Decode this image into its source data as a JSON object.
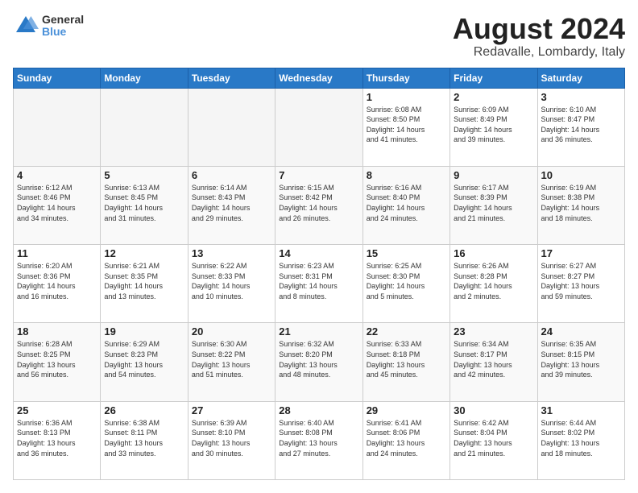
{
  "header": {
    "logo_general": "General",
    "logo_blue": "Blue",
    "title": "August 2024",
    "subtitle": "Redavalle, Lombardy, Italy"
  },
  "weekdays": [
    "Sunday",
    "Monday",
    "Tuesday",
    "Wednesday",
    "Thursday",
    "Friday",
    "Saturday"
  ],
  "weeks": [
    [
      {
        "day": "",
        "info": ""
      },
      {
        "day": "",
        "info": ""
      },
      {
        "day": "",
        "info": ""
      },
      {
        "day": "",
        "info": ""
      },
      {
        "day": "1",
        "info": "Sunrise: 6:08 AM\nSunset: 8:50 PM\nDaylight: 14 hours\nand 41 minutes."
      },
      {
        "day": "2",
        "info": "Sunrise: 6:09 AM\nSunset: 8:49 PM\nDaylight: 14 hours\nand 39 minutes."
      },
      {
        "day": "3",
        "info": "Sunrise: 6:10 AM\nSunset: 8:47 PM\nDaylight: 14 hours\nand 36 minutes."
      }
    ],
    [
      {
        "day": "4",
        "info": "Sunrise: 6:12 AM\nSunset: 8:46 PM\nDaylight: 14 hours\nand 34 minutes."
      },
      {
        "day": "5",
        "info": "Sunrise: 6:13 AM\nSunset: 8:45 PM\nDaylight: 14 hours\nand 31 minutes."
      },
      {
        "day": "6",
        "info": "Sunrise: 6:14 AM\nSunset: 8:43 PM\nDaylight: 14 hours\nand 29 minutes."
      },
      {
        "day": "7",
        "info": "Sunrise: 6:15 AM\nSunset: 8:42 PM\nDaylight: 14 hours\nand 26 minutes."
      },
      {
        "day": "8",
        "info": "Sunrise: 6:16 AM\nSunset: 8:40 PM\nDaylight: 14 hours\nand 24 minutes."
      },
      {
        "day": "9",
        "info": "Sunrise: 6:17 AM\nSunset: 8:39 PM\nDaylight: 14 hours\nand 21 minutes."
      },
      {
        "day": "10",
        "info": "Sunrise: 6:19 AM\nSunset: 8:38 PM\nDaylight: 14 hours\nand 18 minutes."
      }
    ],
    [
      {
        "day": "11",
        "info": "Sunrise: 6:20 AM\nSunset: 8:36 PM\nDaylight: 14 hours\nand 16 minutes."
      },
      {
        "day": "12",
        "info": "Sunrise: 6:21 AM\nSunset: 8:35 PM\nDaylight: 14 hours\nand 13 minutes."
      },
      {
        "day": "13",
        "info": "Sunrise: 6:22 AM\nSunset: 8:33 PM\nDaylight: 14 hours\nand 10 minutes."
      },
      {
        "day": "14",
        "info": "Sunrise: 6:23 AM\nSunset: 8:31 PM\nDaylight: 14 hours\nand 8 minutes."
      },
      {
        "day": "15",
        "info": "Sunrise: 6:25 AM\nSunset: 8:30 PM\nDaylight: 14 hours\nand 5 minutes."
      },
      {
        "day": "16",
        "info": "Sunrise: 6:26 AM\nSunset: 8:28 PM\nDaylight: 14 hours\nand 2 minutes."
      },
      {
        "day": "17",
        "info": "Sunrise: 6:27 AM\nSunset: 8:27 PM\nDaylight: 13 hours\nand 59 minutes."
      }
    ],
    [
      {
        "day": "18",
        "info": "Sunrise: 6:28 AM\nSunset: 8:25 PM\nDaylight: 13 hours\nand 56 minutes."
      },
      {
        "day": "19",
        "info": "Sunrise: 6:29 AM\nSunset: 8:23 PM\nDaylight: 13 hours\nand 54 minutes."
      },
      {
        "day": "20",
        "info": "Sunrise: 6:30 AM\nSunset: 8:22 PM\nDaylight: 13 hours\nand 51 minutes."
      },
      {
        "day": "21",
        "info": "Sunrise: 6:32 AM\nSunset: 8:20 PM\nDaylight: 13 hours\nand 48 minutes."
      },
      {
        "day": "22",
        "info": "Sunrise: 6:33 AM\nSunset: 8:18 PM\nDaylight: 13 hours\nand 45 minutes."
      },
      {
        "day": "23",
        "info": "Sunrise: 6:34 AM\nSunset: 8:17 PM\nDaylight: 13 hours\nand 42 minutes."
      },
      {
        "day": "24",
        "info": "Sunrise: 6:35 AM\nSunset: 8:15 PM\nDaylight: 13 hours\nand 39 minutes."
      }
    ],
    [
      {
        "day": "25",
        "info": "Sunrise: 6:36 AM\nSunset: 8:13 PM\nDaylight: 13 hours\nand 36 minutes."
      },
      {
        "day": "26",
        "info": "Sunrise: 6:38 AM\nSunset: 8:11 PM\nDaylight: 13 hours\nand 33 minutes."
      },
      {
        "day": "27",
        "info": "Sunrise: 6:39 AM\nSunset: 8:10 PM\nDaylight: 13 hours\nand 30 minutes."
      },
      {
        "day": "28",
        "info": "Sunrise: 6:40 AM\nSunset: 8:08 PM\nDaylight: 13 hours\nand 27 minutes."
      },
      {
        "day": "29",
        "info": "Sunrise: 6:41 AM\nSunset: 8:06 PM\nDaylight: 13 hours\nand 24 minutes."
      },
      {
        "day": "30",
        "info": "Sunrise: 6:42 AM\nSunset: 8:04 PM\nDaylight: 13 hours\nand 21 minutes."
      },
      {
        "day": "31",
        "info": "Sunrise: 6:44 AM\nSunset: 8:02 PM\nDaylight: 13 hours\nand 18 minutes."
      }
    ]
  ]
}
